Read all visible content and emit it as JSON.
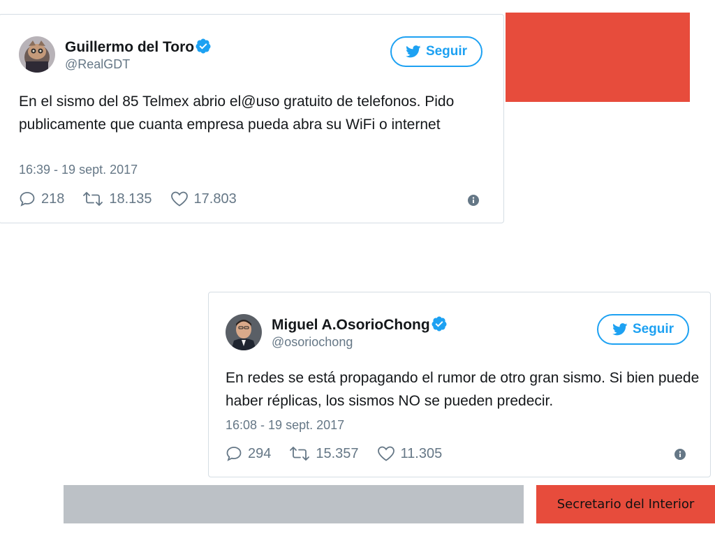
{
  "colors": {
    "accent_red": "#e74c3c",
    "twitter_blue": "#1da1f2",
    "gray_bar": "#bcc1c6"
  },
  "tweets": [
    {
      "display_name": "Guillermo del Toro",
      "handle": "@RealGDT",
      "verified": true,
      "follow_label": "Seguir",
      "text": "En el sismo del 85 Telmex abrio el@uso gratuito de telefonos. Pido publicamente que cuanta empresa pueda abra su WiFi o internet",
      "timestamp": "16:39 - 19 sept. 2017",
      "replies": "218",
      "retweets": "18.135",
      "likes": "17.803"
    },
    {
      "display_name": "Miguel A.OsorioChong",
      "handle": "@osoriochong",
      "verified": true,
      "follow_label": "Seguir",
      "text": "En redes se está propagando el rumor de otro gran sismo. Si bien puede haber réplicas, los sismos NO se pueden predecir.",
      "timestamp": "16:08 - 19 sept. 2017",
      "replies": "294",
      "retweets": "15.357",
      "likes": "11.305"
    }
  ],
  "caption": {
    "text": "Secretario del Interior"
  }
}
